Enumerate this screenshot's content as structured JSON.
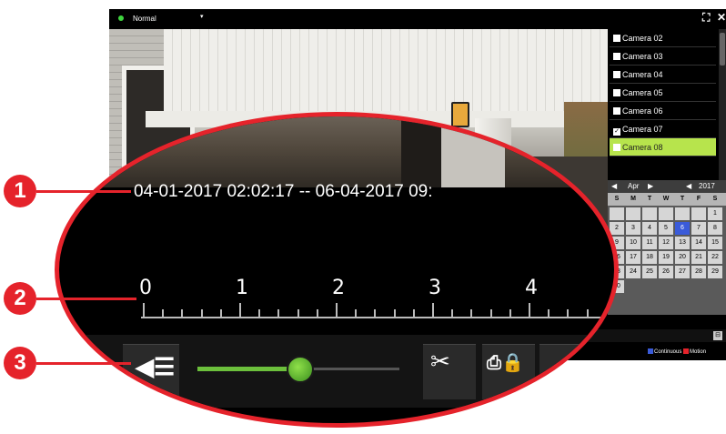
{
  "top_bar": {
    "mode": "Normal",
    "mode_caret": "▾",
    "fullscreen_icon": "expand-icon",
    "close_icon": "close-icon",
    "fullscreen_glyph": "⛶",
    "close_glyph": "✕"
  },
  "camera_list": {
    "items": [
      {
        "label": "Camera 02",
        "checked": false
      },
      {
        "label": "Camera 03",
        "checked": false
      },
      {
        "label": "Camera 04",
        "checked": false
      },
      {
        "label": "Camera 05",
        "checked": false
      },
      {
        "label": "Camera 06",
        "checked": false
      },
      {
        "label": "Camera 07",
        "checked": true
      },
      {
        "label": "Camera 08",
        "checked": false,
        "selected": true
      }
    ]
  },
  "calendar": {
    "month": "Apr",
    "year": "2017",
    "prev_glyph": "◀",
    "next_glyph": "▶",
    "weekdays": [
      "S",
      "M",
      "T",
      "W",
      "T",
      "F",
      "S"
    ],
    "days": [
      "",
      "",
      "",
      "",
      "",
      "",
      "1",
      "2",
      "3",
      "4",
      "5",
      "6",
      "7",
      "8",
      "9",
      "10",
      "11",
      "12",
      "13",
      "14",
      "15",
      "16",
      "17",
      "18",
      "19",
      "20",
      "21",
      "22",
      "23",
      "24",
      "25",
      "26",
      "27",
      "28",
      "29",
      "30"
    ],
    "selected_day": "6"
  },
  "timeline": {
    "expand": "⊟"
  },
  "legend": {
    "continuous": "Continuous",
    "motion": "Motion",
    "continuous_color": "#3a5bd9",
    "motion_color": "#e5232b"
  },
  "magnified": {
    "time_range": "04-01-2017 02:02:17 -- 06-04-2017 09:",
    "scale_labels": [
      "0",
      "1",
      "2",
      "3",
      "4"
    ],
    "speaker_glyph": "◀☰",
    "cut_glyph": "✂",
    "lock_glyph": "⎙🔒",
    "volume_level": 0.5
  },
  "callouts": [
    "1",
    "2",
    "3"
  ],
  "colors": {
    "accent_red": "#e5232b",
    "selected_green": "#b7e44c",
    "slider_green": "#6cc03c"
  }
}
